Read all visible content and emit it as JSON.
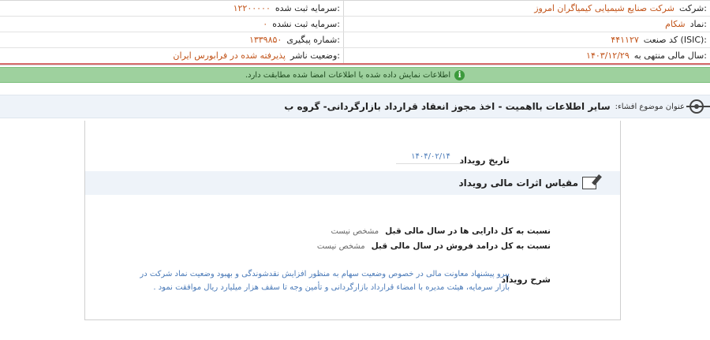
{
  "company": {
    "company_label": "شرکت:",
    "company_value": "شرکت صنایع شیمیایی کیمیاگران امروز",
    "symbol_label": "نماد:",
    "symbol_value": "شکام",
    "isic_label": "کد صنعت (ISIC):",
    "isic_value": "۴۴۱۱۲۷",
    "fiscal_label": "سال مالی منتهی به:",
    "fiscal_value": "۱۴۰۳/۱۲/۲۹",
    "capital_reg_label": "سرمایه ثبت شده:",
    "capital_reg_value": "۱۲۲۰۰۰۰۰",
    "capital_unreg_label": "سرمایه ثبت نشده:",
    "capital_unreg_value": "۰",
    "tracking_label": "شماره پیگیری:",
    "tracking_value": "۱۳۳۹۸۵۰",
    "publisher_label": "وضعیت ناشر:",
    "publisher_value": "پذیرفته شده در فرابورس ایران"
  },
  "banner": {
    "icon": "info-icon",
    "text": "اطلاعات نمایش داده شده با اطلاعات امضا شده مطابقت دارد.",
    "color": "#9ed19e"
  },
  "subject": {
    "icon": "target-icon",
    "label": "عنوان موضوع افشاء:",
    "title": "سایر اطلاعات بااهمیت - اخذ مجوز انعقاد قرارداد بازارگردانی- گروه ب"
  },
  "event": {
    "date_label": "تاریخ رویداد",
    "date_value": "۱۴۰۴/۰۲/۱۴"
  },
  "section": {
    "icon": "edit-icon",
    "title": "مقیاس اثرات مالی رویداد"
  },
  "ratios": [
    {
      "label": "نسبت به کل دارایی ها در سال مالی قبل",
      "value": "مشخص نیست"
    },
    {
      "label": "نسبت به کل درامد فروش در سال مالی قبل",
      "value": "مشخص نیست"
    }
  ],
  "description": {
    "label": "شرح رویداد",
    "text": "پیرو پیشنهاد معاونت مالی در خصوص وضعیت سهام به منظور افزایش نقدشوندگی و بهبود وضعیت نماد شرکت در بازار سرمایه، هیئت مدیره با امضاء قرارداد بازارگردانی و تأمین وجه تا سقف هزار میلیارد ریال موافقت نمود ."
  }
}
